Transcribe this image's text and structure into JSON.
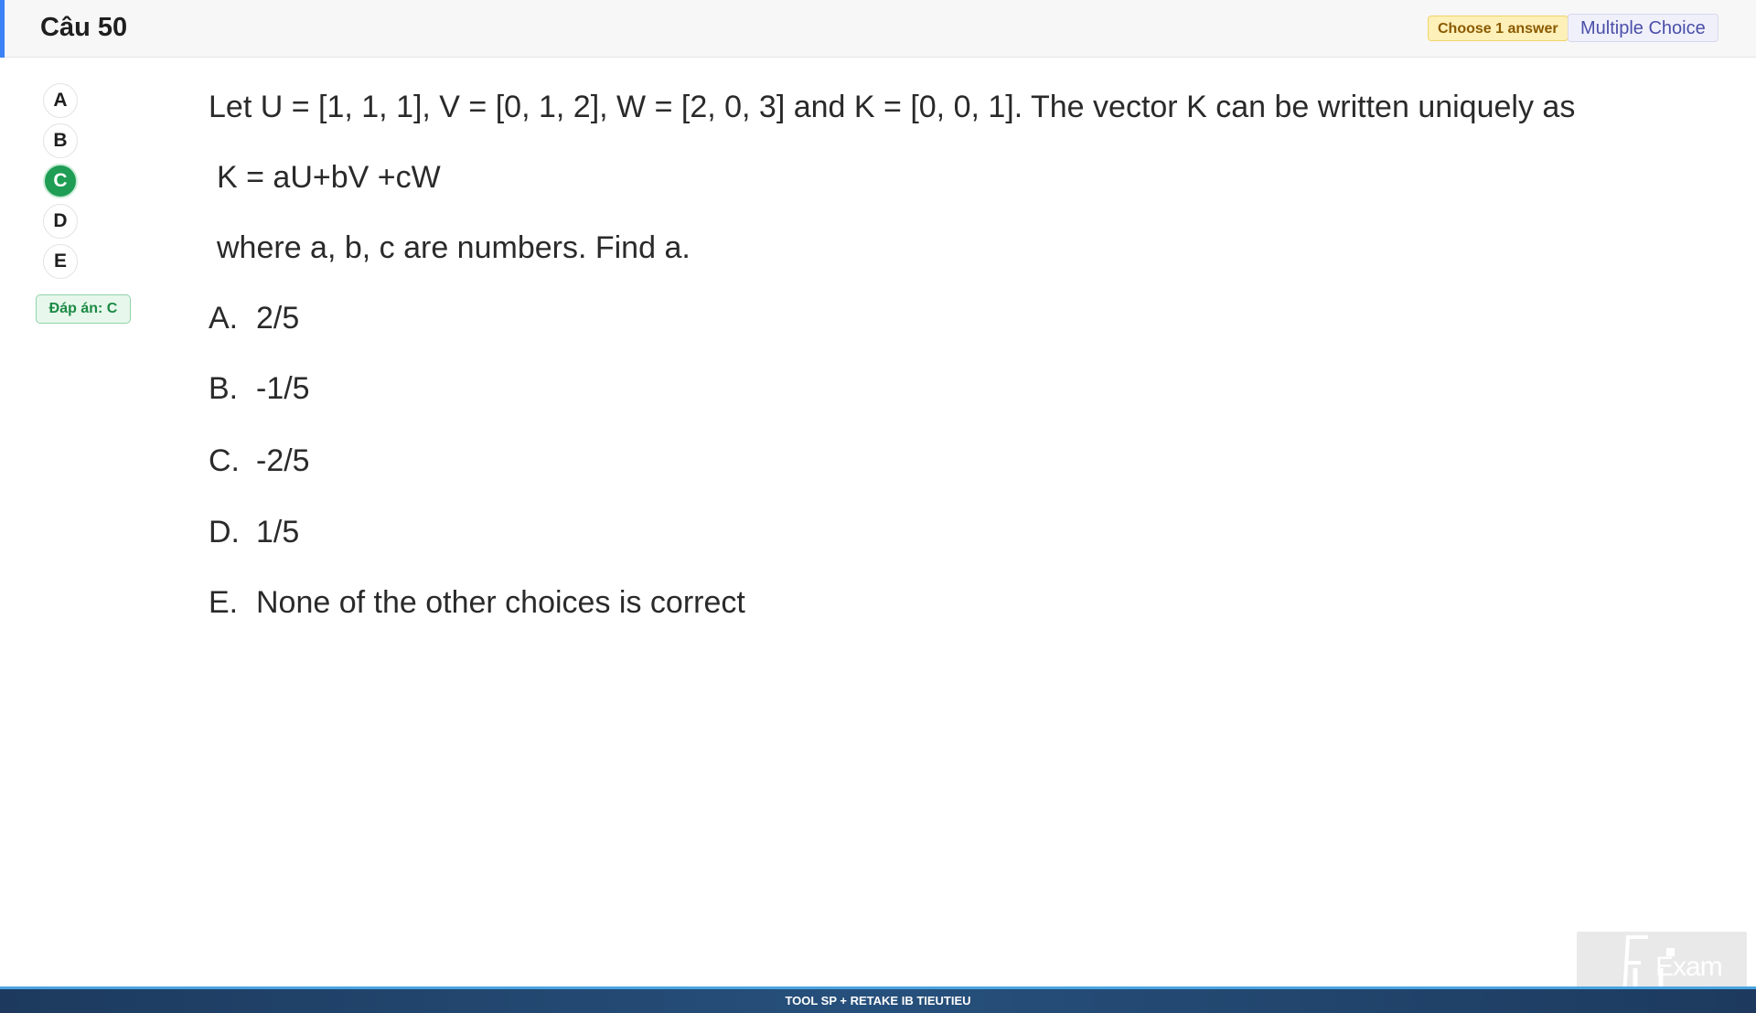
{
  "header": {
    "title": "Câu 50",
    "choose_badge": "Choose 1 answer",
    "type_badge": "Multiple Choice",
    "accent_color": "#3b82f6"
  },
  "options_sidebar": {
    "items": [
      {
        "label": "A",
        "selected": false
      },
      {
        "label": "B",
        "selected": false
      },
      {
        "label": "C",
        "selected": true
      },
      {
        "label": "D",
        "selected": false
      },
      {
        "label": "E",
        "selected": false
      }
    ],
    "answer_badge": "Đáp án: C",
    "selected_color": "#1f9d55"
  },
  "question": {
    "line1": "Let U = [1,  1,  1], V = [0, 1, 2], W = [2, 0, 3] and K = [0, 0, 1]. The vector K can be written uniquely as",
    "line2": "K = aU+bV +cW",
    "line3": "where a, b, c are numbers. Find a.",
    "choices": [
      {
        "letter": "A.",
        "text": "2/5"
      },
      {
        "letter": "B.",
        "text": "-1/5"
      },
      {
        "letter": "C.",
        "text": "-2/5"
      },
      {
        "letter": "D.",
        "text": "1/5"
      },
      {
        "letter": "E.",
        "text": "None of the other choices is correct"
      }
    ]
  },
  "footer": {
    "text": "TOOL SP + RETAKE IB TIEUTIEU"
  },
  "logo": {
    "text": "Exam"
  }
}
